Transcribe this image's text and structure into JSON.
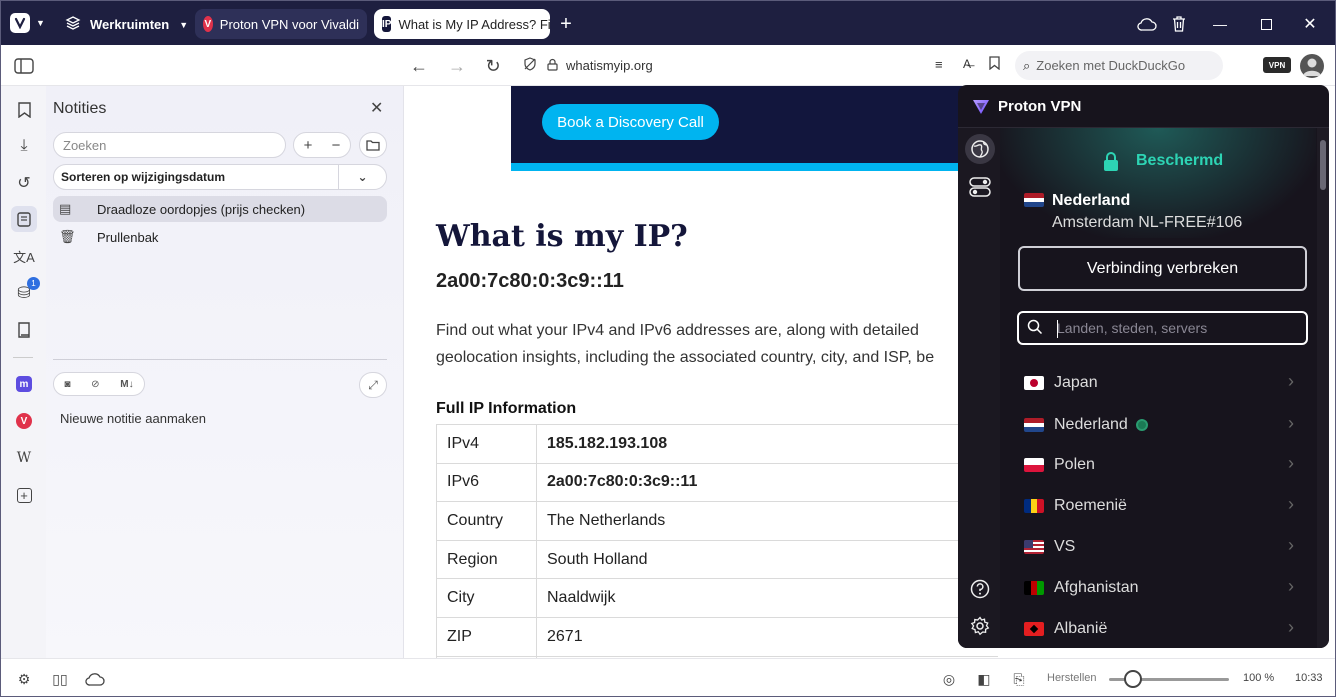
{
  "titlebar": {
    "workspaces_label": "Werkruimten",
    "tabs": [
      {
        "label": "Proton VPN voor Vivaldi",
        "active": false
      },
      {
        "label": "What is My IP Address? Fin",
        "active": true
      }
    ]
  },
  "addressbar": {
    "url": "whatismyip.org",
    "search_placeholder": "Zoeken met DuckDuckGo",
    "vpn_badge": "VPN"
  },
  "sidebar": {
    "mail_badge": "1"
  },
  "notes": {
    "title": "Notities",
    "search_placeholder": "Zoeken",
    "sort_label": "Sorteren op wijzigingsdatum",
    "items": [
      {
        "label": "Draadloze oordopjes (prijs checken)",
        "selected": true
      },
      {
        "label": "Prullenbak",
        "selected": false
      }
    ],
    "new_note_label": "Nieuwe notitie aanmaken",
    "md_label": "M↓"
  },
  "page": {
    "cta_label": "Book a Discovery Call",
    "heading": "What is my IP?",
    "ipv6_address": "2a00:7c80:0:3c9::11",
    "description_line1": "Find out what your IPv4 and IPv6 addresses are, along with detailed",
    "description_line2": "geolocation insights, including the associated country, city, and ISP, be",
    "table_title": "Full IP Information",
    "rows": [
      {
        "key": "IPv4",
        "value": "185.182.193.108",
        "bold": true
      },
      {
        "key": "IPv6",
        "value": "2a00:7c80:0:3c9::11",
        "bold": true
      },
      {
        "key": "Country",
        "value": "The Netherlands",
        "bold": false
      },
      {
        "key": "Region",
        "value": "South Holland",
        "bold": false
      },
      {
        "key": "City",
        "value": "Naaldwijk",
        "bold": false
      },
      {
        "key": "ZIP",
        "value": "2671",
        "bold": false
      }
    ]
  },
  "vpn": {
    "brand": "Proton VPN",
    "status": "Beschermd",
    "connected_country": "Nederland",
    "connected_server": "Amsterdam NL-FREE#106",
    "disconnect_label": "Verbinding verbreken",
    "search_placeholder": "Landen, steden, servers",
    "countries": [
      {
        "name": "Japan",
        "online": false
      },
      {
        "name": "Nederland",
        "online": true
      },
      {
        "name": "Polen",
        "online": false
      },
      {
        "name": "Roemenië",
        "online": false
      },
      {
        "name": "VS",
        "online": false
      },
      {
        "name": "Afghanistan",
        "online": false
      },
      {
        "name": "Albanië",
        "online": false
      }
    ],
    "accent_color": "#2dd4b4"
  },
  "statusbar": {
    "reset_label": "Herstellen",
    "zoom_value": "100 %",
    "zoom_fraction": 0.2,
    "clock": "10:33"
  }
}
